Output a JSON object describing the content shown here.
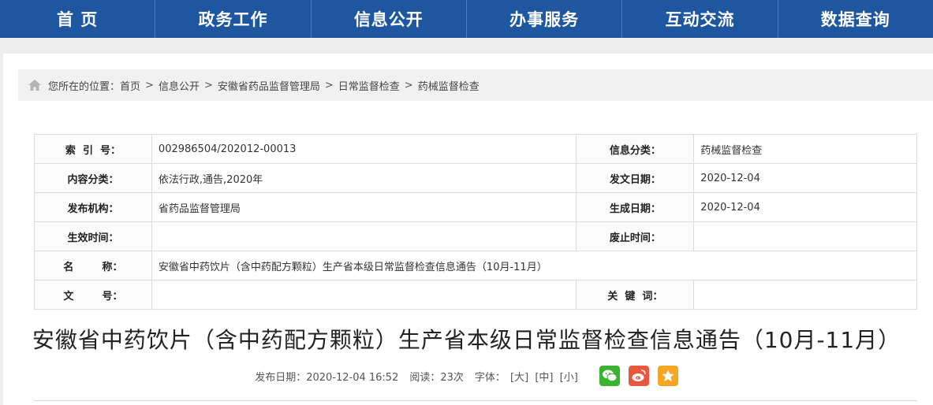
{
  "nav": {
    "items": [
      {
        "label": "首 页"
      },
      {
        "label": "政务工作"
      },
      {
        "label": "信息公开"
      },
      {
        "label": "办事服务"
      },
      {
        "label": "互动交流"
      },
      {
        "label": "数据查询"
      }
    ]
  },
  "breadcrumb": {
    "prefix": "您所在的位置：",
    "items": [
      {
        "label": "首页"
      },
      {
        "label": "信息公开"
      },
      {
        "label": "安徽省药品监督管理局"
      },
      {
        "label": "日常监督检查"
      },
      {
        "label": "药械监督检查"
      }
    ],
    "separator": ">"
  },
  "meta": {
    "index_label": "索  引  号：",
    "index_value": "002986504/202012-00013",
    "category_label": "信息分类：",
    "category_value": "药械监督检查",
    "content_type_label": "内容分类：",
    "content_type_value": "依法行政,通告,2020年",
    "issue_date_label": "发文日期：",
    "issue_date_value": "2020-12-04",
    "publisher_label": "发布机构：",
    "publisher_value": "省药品监督管理局",
    "created_label": "生成日期：",
    "created_value": "2020-12-04",
    "effective_label": "生效时间：",
    "effective_value": "",
    "repeal_label": "废止时间：",
    "repeal_value": "",
    "name_label": "名        称：",
    "name_value": "安徽省中药饮片（含中药配方颗粒）生产省本级日常监督检查信息通告（10月-11月）",
    "doc_no_label": "文        号：",
    "doc_no_value": "",
    "keywords_label": "关  键  词：",
    "keywords_value": ""
  },
  "article": {
    "title": "安徽省中药饮片（含中药配方颗粒）生产省本级日常监督检查信息通告（10月-11月）",
    "published": "发布日期：2020-12-04 16:52",
    "views": "阅读：23次",
    "font_label": "字体：",
    "font_large": "[大]",
    "font_medium": "[中]",
    "font_small": "[小]"
  },
  "colors": {
    "nav_bg": "#1e56a0",
    "wechat": "#3bb230",
    "weibo": "#e9573f",
    "favorite": "#f5a623"
  },
  "icons": {
    "home": "home-icon",
    "wechat": "wechat-icon",
    "weibo": "weibo-icon",
    "favorite": "star-icon"
  }
}
